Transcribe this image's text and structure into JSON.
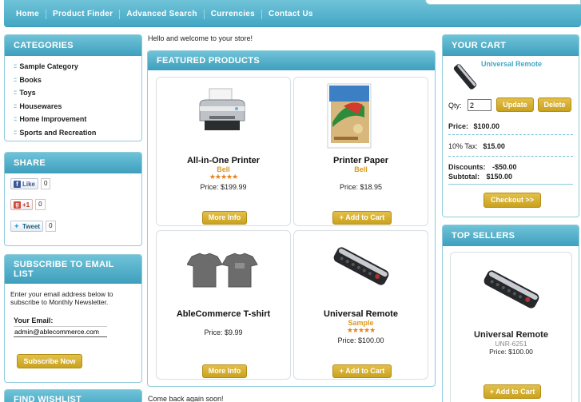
{
  "nav": {
    "items": [
      "Home",
      "Product Finder",
      "Advanced Search",
      "Currencies",
      "Contact Us"
    ]
  },
  "categories": {
    "title": "CATEGORIES",
    "items": [
      "Sample Category",
      "Books",
      "Toys",
      "Housewares",
      "Home Improvement",
      "Sports and Recreation"
    ]
  },
  "share": {
    "title": "SHARE",
    "facebook": {
      "label": "Like",
      "count": "0"
    },
    "google": {
      "label": "+1",
      "count": "0"
    },
    "twitter": {
      "label": "Tweet",
      "count": "0"
    }
  },
  "subscribe": {
    "title": "SUBSCRIBE TO EMAIL LIST",
    "text": "Enter your email address below to subscribe to Monthly Newsletter.",
    "email_label": "Your Email:",
    "email_value": "admin@ablecommerce.com",
    "button": "Subscribe Now"
  },
  "wishlist": {
    "title": "FIND WISHLIST"
  },
  "main": {
    "welcome": "Hello and welcome to your store!",
    "featured_title": "FEATURED PRODUCTS",
    "footer_text": "Come back again soon!",
    "products": [
      {
        "name": "All-in-One Printer",
        "brand": "Bell",
        "stars": "★★★★★",
        "price": "Price: $199.99",
        "button": "More Info",
        "image": "printer-image"
      },
      {
        "name": "Printer Paper",
        "brand": "Bell",
        "stars": "",
        "price": "Price: $18.95",
        "button": "+ Add to Cart",
        "image": "paper-image"
      },
      {
        "name": "AbleCommerce T-shirt",
        "brand": "",
        "stars": "",
        "price": "Price: $9.99",
        "button": "More Info",
        "image": "tshirt-image"
      },
      {
        "name": "Universal Remote",
        "brand": "Sample",
        "stars": "★★★★★",
        "price": "Price: $100.00",
        "button": "+ Add to Cart",
        "image": "remote-image"
      }
    ]
  },
  "cart": {
    "title": "YOUR CART",
    "item_name": "Universal Remote",
    "qty_label": "Qty:",
    "qty_value": "2",
    "update": "Update",
    "delete": "Delete",
    "price_label": "Price:",
    "price_value": "$100.00",
    "tax_label": "10% Tax:",
    "tax_value": "$15.00",
    "discounts_label": "Discounts:",
    "discounts_value": "-$50.00",
    "subtotal_label": "Subtotal:",
    "subtotal_value": "$150.00",
    "checkout": "Checkout >>"
  },
  "top_sellers": {
    "title": "TOP SELLERS",
    "name": "Universal Remote",
    "sku": "UNR-6251",
    "price": "Price: $100.00",
    "button": "+ Add to Cart"
  },
  "colors": {
    "accent": "#45a8c5",
    "button": "#d4ad2c",
    "brand_text": "#d89a1e"
  }
}
